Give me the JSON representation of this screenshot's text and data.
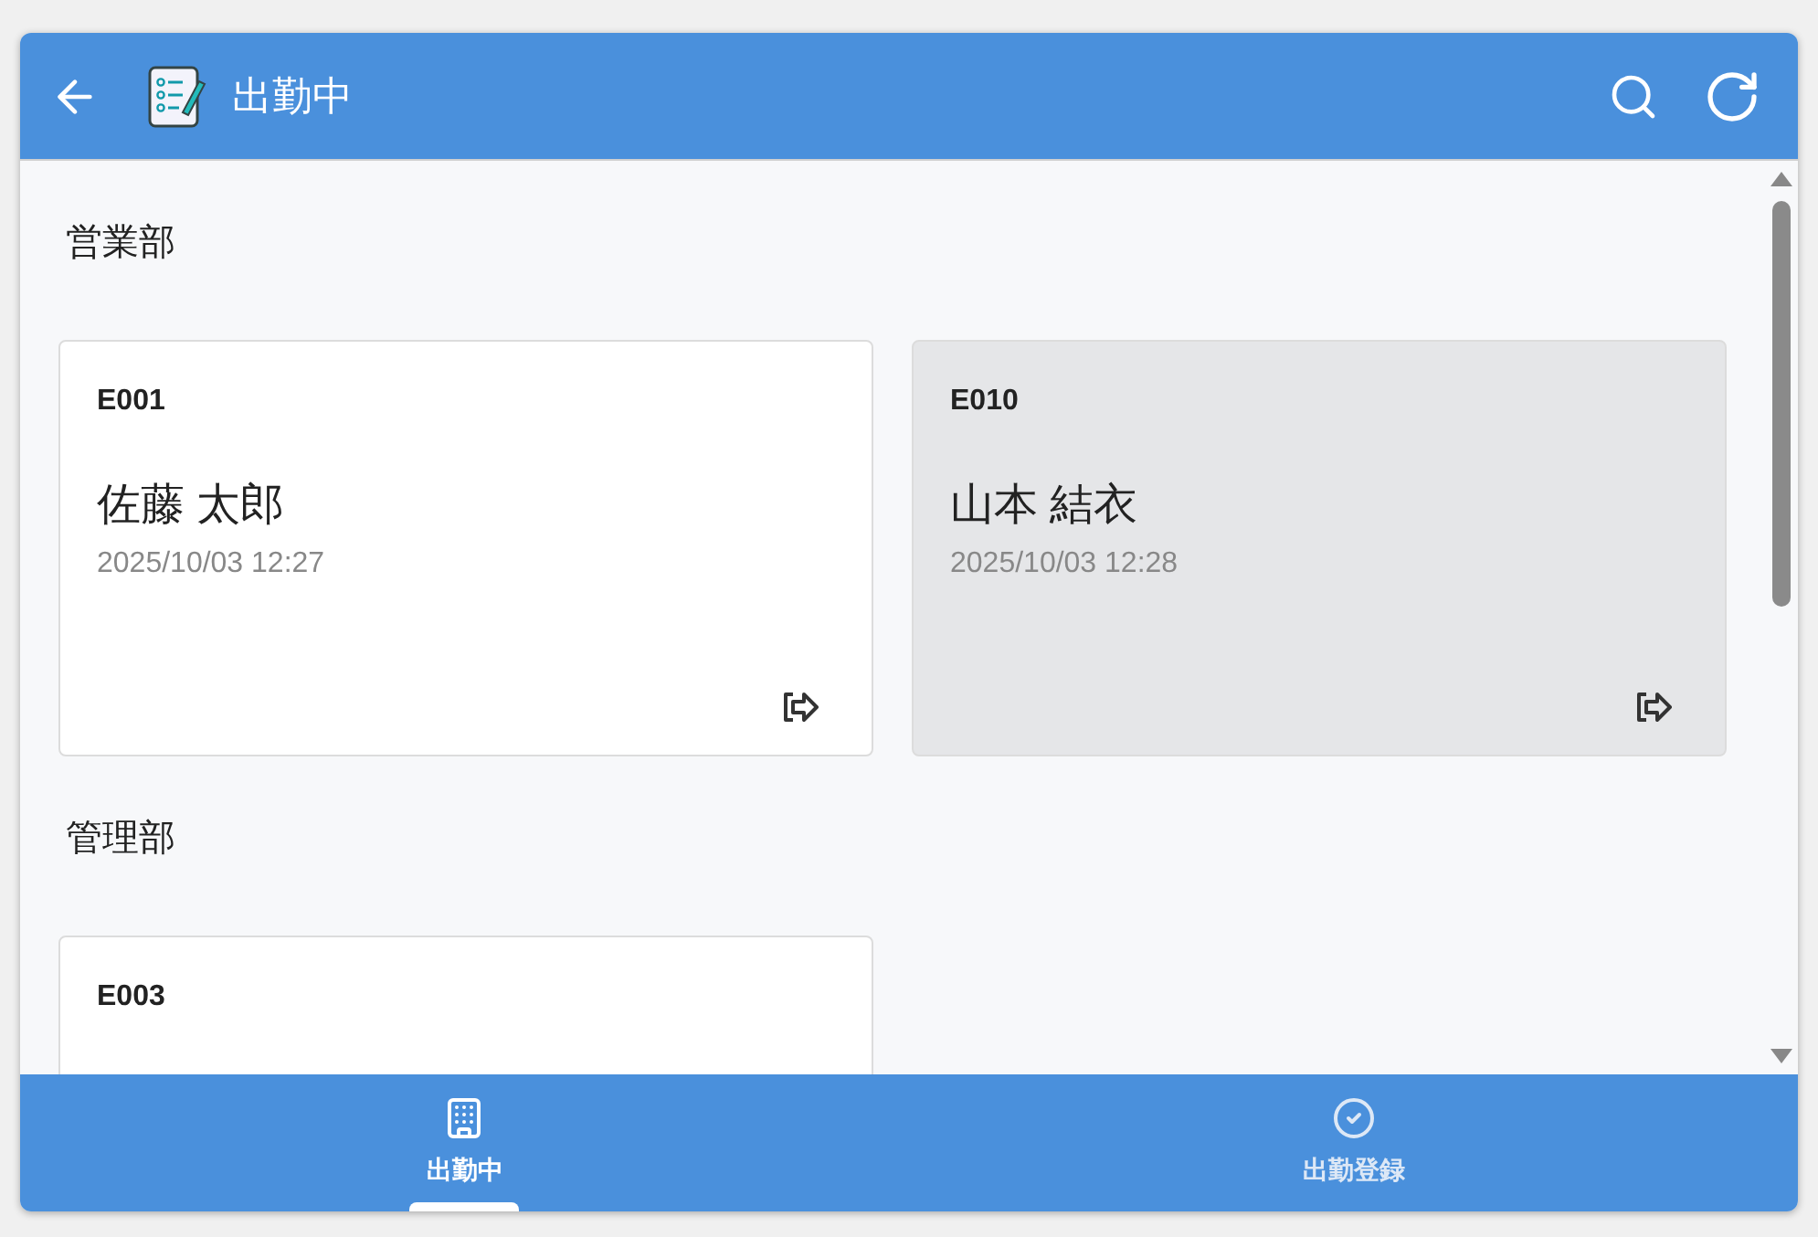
{
  "header": {
    "title": "出勤中"
  },
  "sections": [
    {
      "title": "営業部",
      "cards": [
        {
          "id": "E001",
          "name": "佐藤 太郎",
          "time": "2025/10/03 12:27",
          "selected": false
        },
        {
          "id": "E010",
          "name": "山本 結衣",
          "time": "2025/10/03 12:28",
          "selected": true
        }
      ]
    },
    {
      "title": "管理部",
      "cards": [
        {
          "id": "E003",
          "selected": false
        }
      ]
    }
  ],
  "bottom_nav": [
    {
      "label": "出勤中",
      "selected": true
    },
    {
      "label": "出勤登録",
      "selected": false
    }
  ]
}
